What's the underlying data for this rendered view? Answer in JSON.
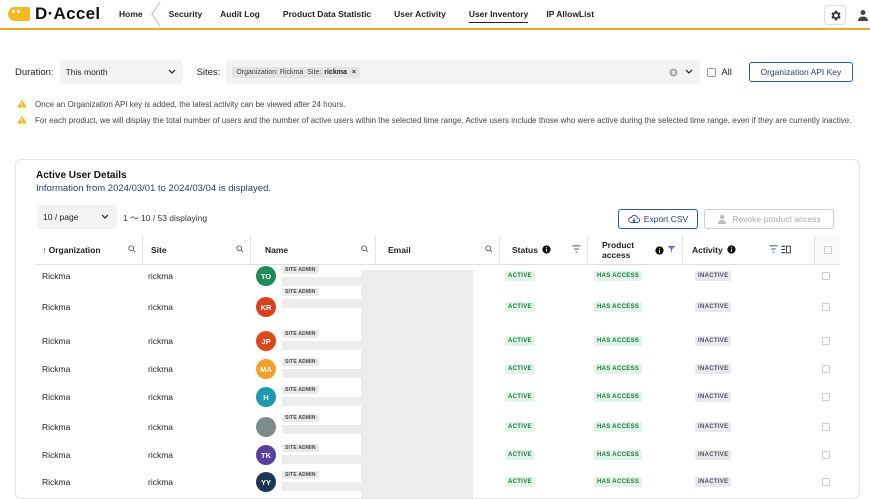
{
  "app": {
    "logo_text": "D·Accel",
    "nav": [
      {
        "label": "Home"
      },
      {
        "label": "Security"
      },
      {
        "label": "Audit Log"
      },
      {
        "label": "Product Data Statistic"
      },
      {
        "label": "User Activity"
      },
      {
        "label": "User Inventory"
      },
      {
        "label": "IP AllowList"
      }
    ],
    "active_nav": "User Inventory",
    "accent_color": "#f5a623"
  },
  "filters": {
    "duration_label": "Duration:",
    "duration_value": "This month",
    "sites_label": "Sites:",
    "site_chip_org_label": "Organization: Rickma",
    "site_chip_site_label": "Site:",
    "site_chip_site_value": "rickma",
    "all_label": "All",
    "org_api_key_button": "Organization API Key"
  },
  "notes": [
    "Once an Organization API key is added, the latest activity can be viewed after 24 hours.",
    "For each product, we will display the total number of users and the number of active users within the selected time range. Active users include those who were active during the selected time range, even if they are currently inactive."
  ],
  "card": {
    "title": "Active User Details",
    "subtitle": "Information from 2024/03/01 to 2024/03/04 is displayed.",
    "per_page": "10 / page",
    "count_text": "1 〜 10 / 53 displaying",
    "export_label": "Export CSV",
    "revoke_label": "Revoke product access"
  },
  "table": {
    "columns": {
      "organization": "↑ Organization",
      "site": "Site",
      "name": "Name",
      "email": "Email",
      "status": "Status",
      "product_access": "Product access",
      "activity": "Activity"
    },
    "site_admin_badge": "SITE ADMIN",
    "rows": [
      {
        "org": "Rickma",
        "site": "rickma",
        "initials": "TO",
        "avatar_color": "#1f8a5a",
        "status": "ACTIVE",
        "access": "HAS ACCESS",
        "activity": "INACTIVE"
      },
      {
        "org": "Rickma",
        "site": "rickma",
        "initials": "KR",
        "avatar_color": "#d8401f",
        "status": "ACTIVE",
        "access": "HAS ACCESS",
        "activity": "INACTIVE"
      },
      {
        "org": "Rickma",
        "site": "rickma",
        "initials": "JP",
        "avatar_color": "#dc4a1c",
        "status": "ACTIVE",
        "access": "HAS ACCESS",
        "activity": "INACTIVE"
      },
      {
        "org": "Rickma",
        "site": "rickma",
        "initials": "MA",
        "avatar_color": "#f2a02a",
        "status": "ACTIVE",
        "access": "HAS ACCESS",
        "activity": "INACTIVE"
      },
      {
        "org": "Rickma",
        "site": "rickma",
        "initials": "H",
        "avatar_color": "#1e9aae",
        "status": "ACTIVE",
        "access": "HAS ACCESS",
        "activity": "INACTIVE"
      },
      {
        "org": "Rickma",
        "site": "rickma",
        "initials": "",
        "avatar_color": "#7d8b8a",
        "status": "ACTIVE",
        "access": "HAS ACCESS",
        "activity": "INACTIVE"
      },
      {
        "org": "Rickma",
        "site": "rickma",
        "initials": "TK",
        "avatar_color": "#5a3fa0",
        "status": "ACTIVE",
        "access": "HAS ACCESS",
        "activity": "INACTIVE"
      },
      {
        "org": "Rickma",
        "site": "rickma",
        "initials": "YY",
        "avatar_color": "#1d3557",
        "status": "ACTIVE",
        "access": "HAS ACCESS",
        "activity": "INACTIVE"
      }
    ]
  }
}
